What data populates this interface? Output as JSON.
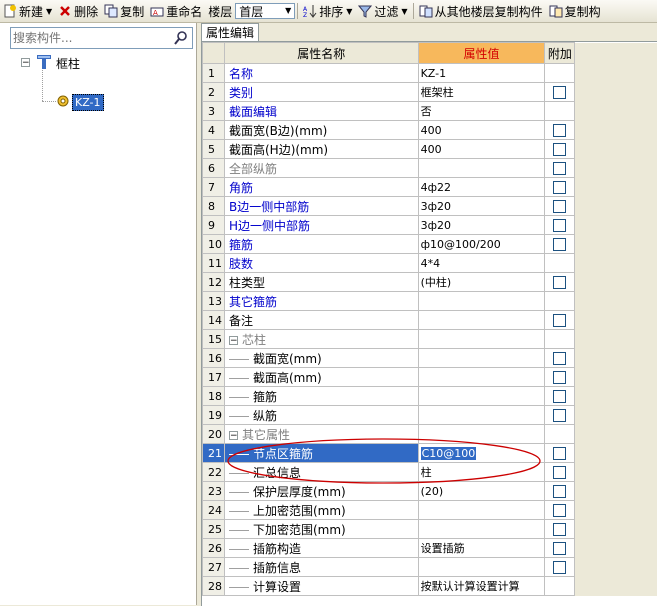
{
  "toolbar": {
    "new_label": "新建",
    "delete_label": "删除",
    "copy_label": "复制",
    "rename_label": "重命名",
    "floor_label": "楼层",
    "floor_value": "首层",
    "sort_label": "排序",
    "filter_label": "过滤",
    "copy_from_floor_label": "从其他楼层复制构件",
    "copy_from_label": "复制构"
  },
  "left_panel": {
    "search_placeholder": "搜索构件...",
    "tree": {
      "root": "框柱",
      "child": "KZ-1"
    }
  },
  "tab": {
    "label": "属性编辑"
  },
  "grid": {
    "headers": {
      "name": "属性名称",
      "value": "属性值",
      "extra": "附加"
    },
    "rows": [
      {
        "num": "1",
        "name": "名称",
        "value": "KZ-1",
        "style": "blue",
        "check": false,
        "indent": 0
      },
      {
        "num": "2",
        "name": "类别",
        "value": "框架柱",
        "style": "blue",
        "check": true,
        "indent": 0
      },
      {
        "num": "3",
        "name": "截面编辑",
        "value": "否",
        "style": "blue",
        "check": false,
        "indent": 0
      },
      {
        "num": "4",
        "name": "截面宽(B边)(mm)",
        "value": "400",
        "style": "black",
        "check": true,
        "indent": 0
      },
      {
        "num": "5",
        "name": "截面高(H边)(mm)",
        "value": "400",
        "style": "black",
        "check": true,
        "indent": 0
      },
      {
        "num": "6",
        "name": "全部纵筋",
        "value": "",
        "style": "gray",
        "check": true,
        "indent": 0
      },
      {
        "num": "7",
        "name": "角筋",
        "value": "4ф22",
        "style": "blue",
        "check": true,
        "indent": 0
      },
      {
        "num": "8",
        "name": "B边一侧中部筋",
        "value": "3ф20",
        "style": "blue",
        "check": true,
        "indent": 0
      },
      {
        "num": "9",
        "name": "H边一侧中部筋",
        "value": "3ф20",
        "style": "blue",
        "check": true,
        "indent": 0
      },
      {
        "num": "10",
        "name": "箍筋",
        "value": "ф10@100/200",
        "style": "blue",
        "check": true,
        "indent": 0
      },
      {
        "num": "11",
        "name": "肢数",
        "value": "4*4",
        "style": "blue",
        "check": false,
        "indent": 0
      },
      {
        "num": "12",
        "name": "柱类型",
        "value": "(中柱)",
        "style": "black",
        "check": true,
        "indent": 0
      },
      {
        "num": "13",
        "name": "其它箍筋",
        "value": "",
        "style": "blue",
        "check": false,
        "indent": 0
      },
      {
        "num": "14",
        "name": "备注",
        "value": "",
        "style": "black",
        "check": true,
        "indent": 0
      },
      {
        "num": "15",
        "name": "芯柱",
        "value": "",
        "style": "gray",
        "check": false,
        "indent": 0,
        "group": true
      },
      {
        "num": "16",
        "name": "截面宽(mm)",
        "value": "",
        "style": "black",
        "check": true,
        "indent": 1
      },
      {
        "num": "17",
        "name": "截面高(mm)",
        "value": "",
        "style": "black",
        "check": true,
        "indent": 1
      },
      {
        "num": "18",
        "name": "箍筋",
        "value": "",
        "style": "black",
        "check": true,
        "indent": 1
      },
      {
        "num": "19",
        "name": "纵筋",
        "value": "",
        "style": "black",
        "check": true,
        "indent": 1
      },
      {
        "num": "20",
        "name": "其它属性",
        "value": "",
        "style": "gray",
        "check": false,
        "indent": 0,
        "group": true
      },
      {
        "num": "21",
        "name": "节点区箍筋",
        "value": "C10@100",
        "style": "white",
        "check": true,
        "indent": 1,
        "selected": true
      },
      {
        "num": "22",
        "name": "汇总信息",
        "value": "柱",
        "style": "black",
        "check": true,
        "indent": 1
      },
      {
        "num": "23",
        "name": "保护层厚度(mm)",
        "value": "(20)",
        "style": "black",
        "check": true,
        "indent": 1
      },
      {
        "num": "24",
        "name": "上加密范围(mm)",
        "value": "",
        "style": "black",
        "check": true,
        "indent": 1
      },
      {
        "num": "25",
        "name": "下加密范围(mm)",
        "value": "",
        "style": "black",
        "check": true,
        "indent": 1
      },
      {
        "num": "26",
        "name": "插筋构造",
        "value": "设置插筋",
        "style": "black",
        "check": true,
        "indent": 1
      },
      {
        "num": "27",
        "name": "插筋信息",
        "value": "",
        "style": "black",
        "check": true,
        "indent": 1
      },
      {
        "num": "28",
        "name": "计算设置",
        "value": "按默认计算设置计算",
        "style": "black",
        "check": false,
        "indent": 1
      }
    ]
  },
  "colors": {
    "selection": "#316ac5",
    "header_value_bg": "#f7b85c",
    "header_value_text": "#d40000",
    "annotation": "#cc0000",
    "blue_text": "#0000cc"
  }
}
